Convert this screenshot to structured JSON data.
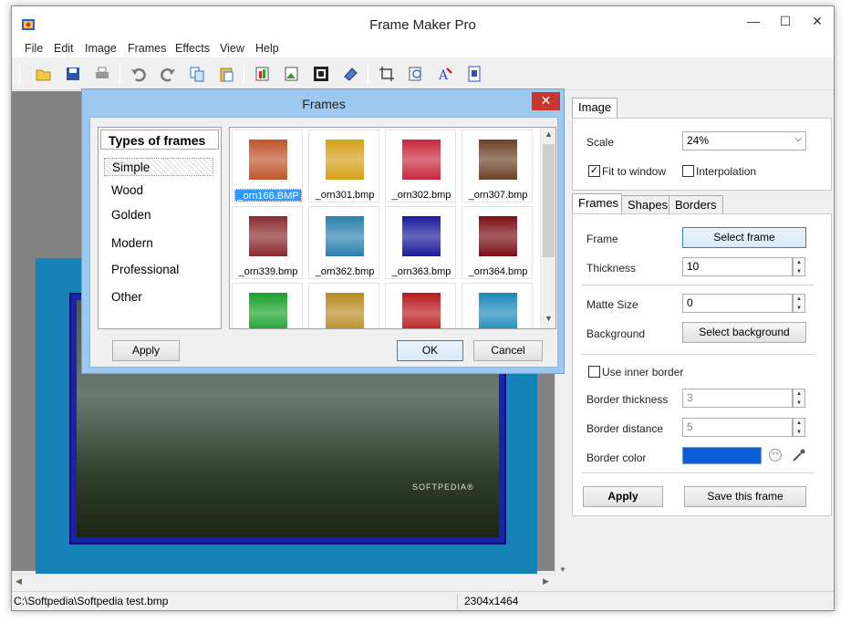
{
  "window": {
    "title": "Frame Maker Pro",
    "minimize_glyph": "—",
    "maximize_glyph": "☐",
    "close_glyph": "✕"
  },
  "menu": [
    "File",
    "Edit",
    "Image",
    "Frames",
    "Effects",
    "View",
    "Help"
  ],
  "toolbar_icons": [
    "open-icon",
    "save-icon",
    "print-icon",
    "undo-icon",
    "redo-icon",
    "copy-icon",
    "paste-icon",
    "image-add-icon",
    "image-export-icon",
    "frame-icon",
    "eraser-icon",
    "crop-icon",
    "zoom-icon",
    "text-icon",
    "page-icon"
  ],
  "canvas": {
    "photo_watermark": "SOFTPEDIA®"
  },
  "dialog": {
    "title": "Frames",
    "close_glyph": "✕",
    "types_header": "Types of frames",
    "types": [
      "Simple",
      "Wood",
      "Golden",
      "Modern",
      "Professional",
      "Other"
    ],
    "selected_type": "Simple",
    "thumbnails": [
      {
        "caption": "_orn166.BMP",
        "color": "#c0552a",
        "selected": true
      },
      {
        "caption": "_orn301.bmp",
        "color": "#d4a017",
        "selected": false
      },
      {
        "caption": "_orn302.bmp",
        "color": "#c8283c",
        "selected": false
      },
      {
        "caption": "_orn307.bmp",
        "color": "#6b4226",
        "selected": false
      },
      {
        "caption": "_orn339.bmp",
        "color": "#8a2a2e",
        "selected": false
      },
      {
        "caption": "_orn362.bmp",
        "color": "#2a7fb0",
        "selected": false
      },
      {
        "caption": "_orn363.bmp",
        "color": "#1a1a9a",
        "selected": false
      },
      {
        "caption": "_orn364.bmp",
        "color": "#7a0e14",
        "selected": false
      },
      {
        "caption": "",
        "color": "#18a028",
        "selected": false
      },
      {
        "caption": "",
        "color": "#b88a22",
        "selected": false
      },
      {
        "caption": "",
        "color": "#b81818",
        "selected": false
      },
      {
        "caption": "",
        "color": "#1a88b8",
        "selected": false
      }
    ],
    "apply_label": "Apply",
    "ok_label": "OK",
    "cancel_label": "Cancel"
  },
  "right_panel": {
    "top_tab": "Image",
    "scale_label": "Scale",
    "scale_value": "24%",
    "fit_to_window_label": "Fit to window",
    "fit_to_window_checked": true,
    "interpolation_label": "Interpolation",
    "interpolation_checked": false,
    "tabs": [
      "Frames",
      "Shapes",
      "Borders"
    ],
    "active_tab": "Frames",
    "frame_label": "Frame",
    "select_frame_label": "Select frame",
    "thickness_label": "Thickness",
    "thickness_value": "10",
    "matte_label": "Matte Size",
    "matte_value": "0",
    "background_label": "Background",
    "select_background_label": "Select background",
    "inner_border_label": "Use inner border",
    "inner_border_checked": false,
    "border_thickness_label": "Border thickness",
    "border_thickness_value": "3",
    "border_distance_label": "Border distance",
    "border_distance_value": "5",
    "border_color_label": "Border color",
    "border_color": "#0a5fd8",
    "apply_label": "Apply",
    "save_frame_label": "Save this frame"
  },
  "status": {
    "path": "C:\\Softpedia\\Softpedia test.bmp",
    "dimensions": "2304x1464"
  }
}
